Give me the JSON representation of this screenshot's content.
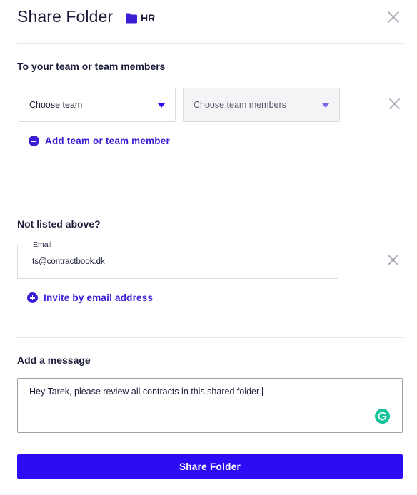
{
  "header": {
    "title": "Share Folder",
    "folder_icon": "folder-icon",
    "folder_name": "HR",
    "close_icon": "close-icon"
  },
  "team_section": {
    "label": "To your team or team members",
    "team_select": {
      "value": "Choose team",
      "icon": "chevron-down-icon"
    },
    "members_select": {
      "value": "Choose team members",
      "icon": "chevron-down-icon",
      "disabled": true
    },
    "remove_icon": "close-icon",
    "add_label": "Add team or team member",
    "add_icon": "plus-circle-icon"
  },
  "email_section": {
    "label": "Not listed above?",
    "email_field": {
      "label": "Email",
      "value": "ts@contractbook.dk"
    },
    "remove_icon": "close-icon",
    "invite_label": "Invite by email address",
    "invite_icon": "plus-circle-icon"
  },
  "message_section": {
    "label": "Add a message",
    "message": "Hey Tarek, please review all contracts in this shared folder.",
    "grammarly_icon": "grammarly-icon"
  },
  "submit": {
    "label": "Share Folder"
  },
  "colors": {
    "accent": "#2c0cf4",
    "link": "#3a1ed6",
    "text": "#1b1d3a",
    "grammarly": "#15c39a"
  }
}
